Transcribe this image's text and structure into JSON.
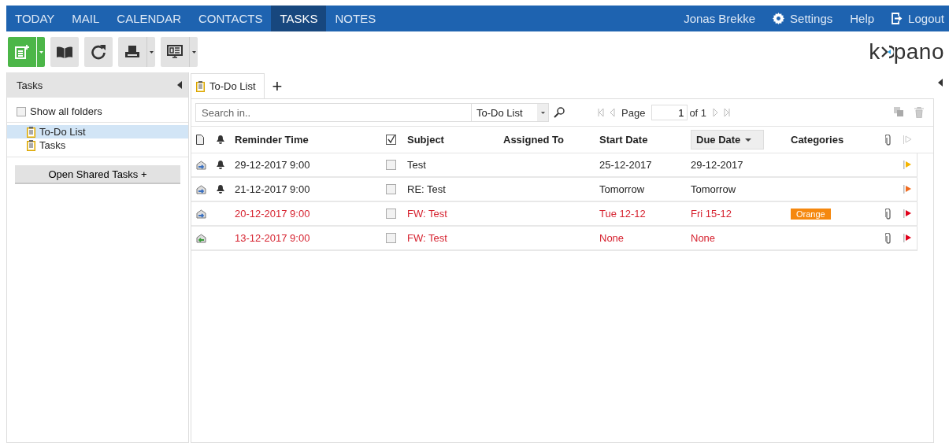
{
  "nav": {
    "tabs": [
      {
        "label": "TODAY",
        "selected": false
      },
      {
        "label": "MAIL",
        "selected": false
      },
      {
        "label": "CALENDAR",
        "selected": false
      },
      {
        "label": "CONTACTS",
        "selected": false
      },
      {
        "label": "TASKS",
        "selected": true
      },
      {
        "label": "NOTES",
        "selected": false
      }
    ],
    "user": "Jonas Brekke",
    "settings": "Settings",
    "help": "Help",
    "logout": "Logout"
  },
  "logo": {
    "left": "k",
    "right": "pano"
  },
  "sidebar": {
    "title": "Tasks",
    "show_all": {
      "label": "Show all folders",
      "checked": false
    },
    "folders": [
      {
        "label": "To-Do List",
        "selected": true
      },
      {
        "label": "Tasks",
        "selected": false
      }
    ],
    "shared_button": "Open Shared Tasks +"
  },
  "content_tabs": [
    {
      "label": "To-Do List",
      "selected": true
    }
  ],
  "add_tab": "+",
  "search": {
    "placeholder": "Search in..",
    "scope": "To-Do List"
  },
  "pager": {
    "label": "Page",
    "value": "1",
    "of": "of 1"
  },
  "table": {
    "columns": [
      "Reminder Time",
      "Subject",
      "Assigned To",
      "Start Date",
      "Due Date",
      "Categories"
    ],
    "rows": [
      {
        "kind": "received",
        "reminder": true,
        "reminder_time": "29-12-2017 9:00",
        "complete": false,
        "subject": "Test",
        "assigned_to": "",
        "start": "25-12-2017",
        "due": "29-12-2017",
        "attachment": false,
        "overdue": false,
        "color": "#f5b400"
      },
      {
        "kind": "received",
        "reminder": true,
        "reminder_time": "21-12-2017 9:00",
        "complete": false,
        "subject": "RE: Test",
        "assigned_to": "",
        "start": "Tomorrow",
        "due": "Tomorrow",
        "attachment": false,
        "overdue": false,
        "color": "#f06a1e"
      },
      {
        "kind": "received",
        "reminder": false,
        "reminder_time": "20-12-2017 9:00",
        "complete": false,
        "subject": "FW: Test",
        "assigned_to": "",
        "start": "Tue 12-12",
        "due": "Fri 15-12",
        "category": {
          "label": "Orange",
          "color": "#f5880f"
        },
        "attachment": true,
        "overdue": true,
        "color": "#e0001a"
      },
      {
        "kind": "sent",
        "reminder": false,
        "reminder_time": "13-12-2017 9:00",
        "complete": false,
        "subject": "FW: Test",
        "assigned_to": "",
        "start": "None",
        "due": "None",
        "attachment": true,
        "overdue": true,
        "color": "#e0001a"
      }
    ]
  }
}
